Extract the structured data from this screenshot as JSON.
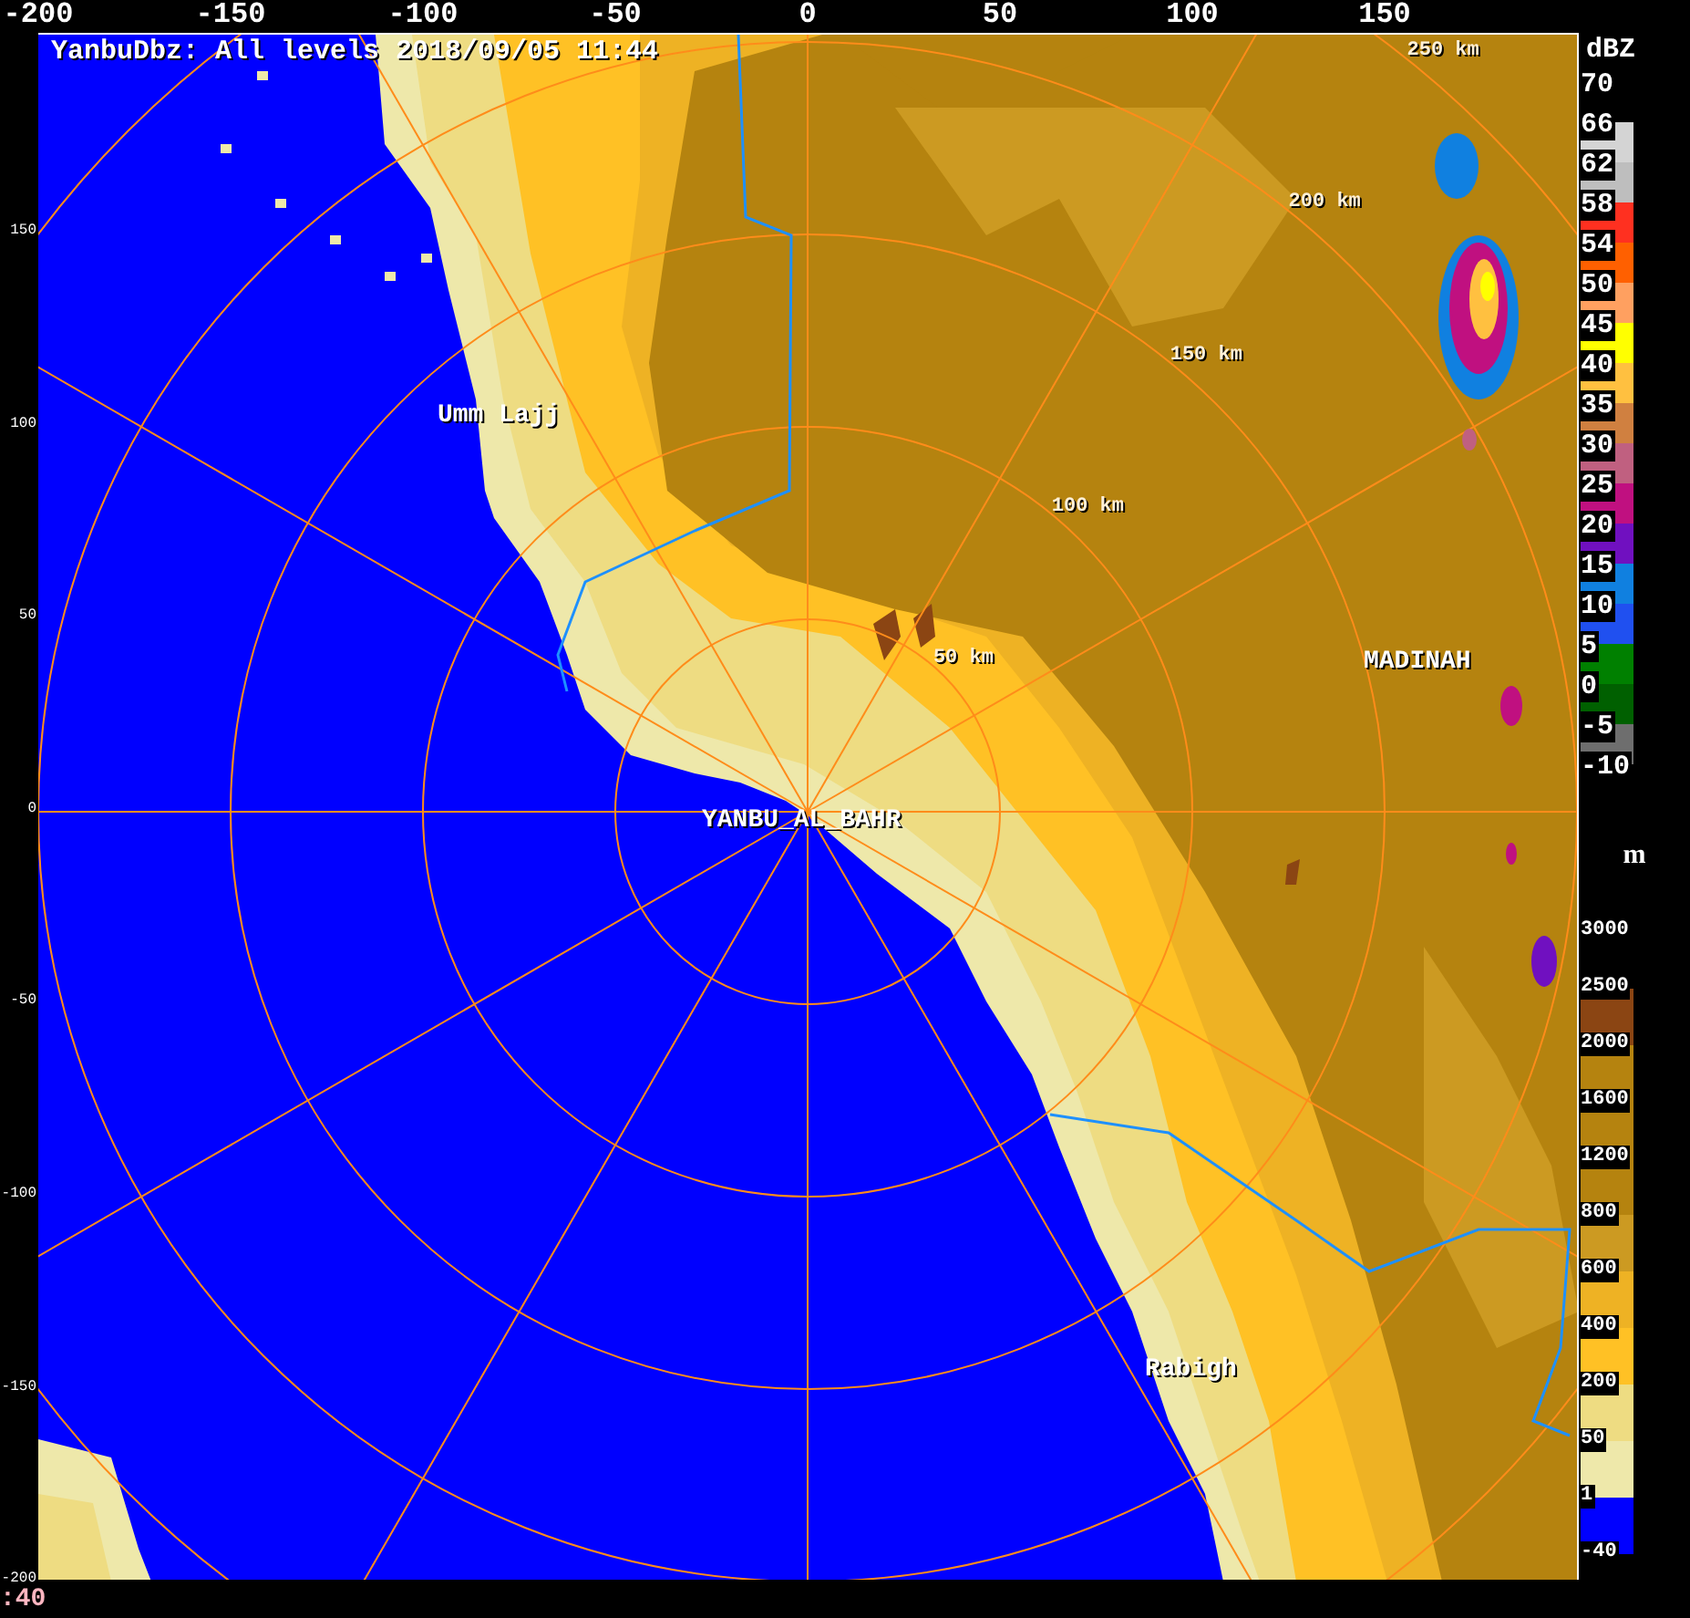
{
  "title": "YanbuDbz: All levels 2018/09/05 11:44",
  "x_axis_labels": [
    "-200",
    "-150",
    "-100",
    "-50",
    "0",
    "50",
    "100",
    "150"
  ],
  "y_axis_labels": [
    "150",
    "100",
    "50",
    "0",
    "-50",
    "-100",
    "-150",
    "-200"
  ],
  "places": [
    "Umm Lajj",
    "YANBU_AL_BAHR",
    "MADINAH",
    "Rabigh"
  ],
  "range_labels": [
    "50 km",
    "100 km",
    "150 km",
    "200 km",
    "250 km"
  ],
  "dbz_legend": {
    "unit": "dBZ",
    "levels": [
      {
        "label": "70"
      },
      {
        "label": "66",
        "color": "#d4d4d4"
      },
      {
        "label": "62",
        "color": "#bebebe"
      },
      {
        "label": "58",
        "color": "#ff3020"
      },
      {
        "label": "54",
        "color": "#ff6000"
      },
      {
        "label": "50",
        "color": "#ffa060"
      },
      {
        "label": "45",
        "color": "#ffff00"
      },
      {
        "label": "40",
        "color": "#ffc040"
      },
      {
        "label": "35",
        "color": "#d08040"
      },
      {
        "label": "30",
        "color": "#c06080"
      },
      {
        "label": "25",
        "color": "#c01080"
      },
      {
        "label": "20",
        "color": "#7010c0"
      },
      {
        "label": "15",
        "color": "#1080e0"
      },
      {
        "label": "10",
        "color": "#2050f0"
      },
      {
        "label": "5",
        "color": "#008000"
      },
      {
        "label": "0",
        "color": "#006000"
      },
      {
        "label": "-5",
        "color": "#6e6e6e"
      },
      {
        "label": "-10"
      }
    ]
  },
  "height_legend": {
    "unit": "m",
    "levels": [
      {
        "label": "3000"
      },
      {
        "label": "2500",
        "color": "#8b4513"
      },
      {
        "label": "2000",
        "color": "#b5830f"
      },
      {
        "label": "1600",
        "color": "#b5830f"
      },
      {
        "label": "1200",
        "color": "#b5830f"
      },
      {
        "label": "800",
        "color": "#cc9a22"
      },
      {
        "label": "600",
        "color": "#eeb224"
      },
      {
        "label": "400",
        "color": "#ffc125"
      },
      {
        "label": "200",
        "color": "#eedc82"
      },
      {
        "label": "50",
        "color": "#eee8aa"
      },
      {
        "label": "1",
        "color": "#0000ff"
      },
      {
        "label": "-40"
      }
    ]
  },
  "corner_label": ":40"
}
